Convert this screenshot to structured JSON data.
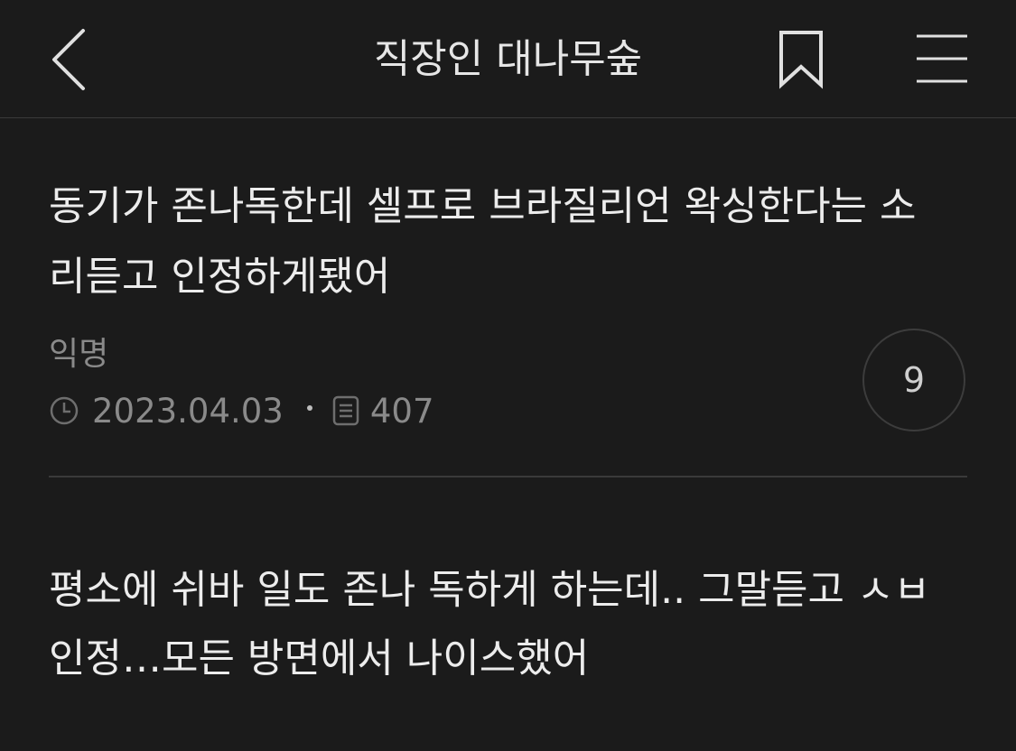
{
  "header": {
    "title": "직장인 대나무숲",
    "back_icon": "chevron-left-icon",
    "bookmark_icon": "bookmark-icon",
    "menu_icon": "hamburger-menu-icon"
  },
  "post": {
    "title": "동기가 존나독한데 셀프로 브라질리언 왁싱한다는 소리듣고 인정하게됐어",
    "author": "익명",
    "date": "2023.04.03",
    "views": "407",
    "comment_count": "9",
    "body": "평소에 쉬바 일도 존나 독하게 하는데.. 그말듣고 ㅅㅂ 인정…모든 방면에서 나이스했어",
    "clock_icon": "clock-icon",
    "views_icon": "document-icon"
  },
  "colors": {
    "background": "#1b1b1b",
    "text": "#ececec",
    "muted": "#8a8a8a",
    "divider": "#3a3a3a"
  }
}
